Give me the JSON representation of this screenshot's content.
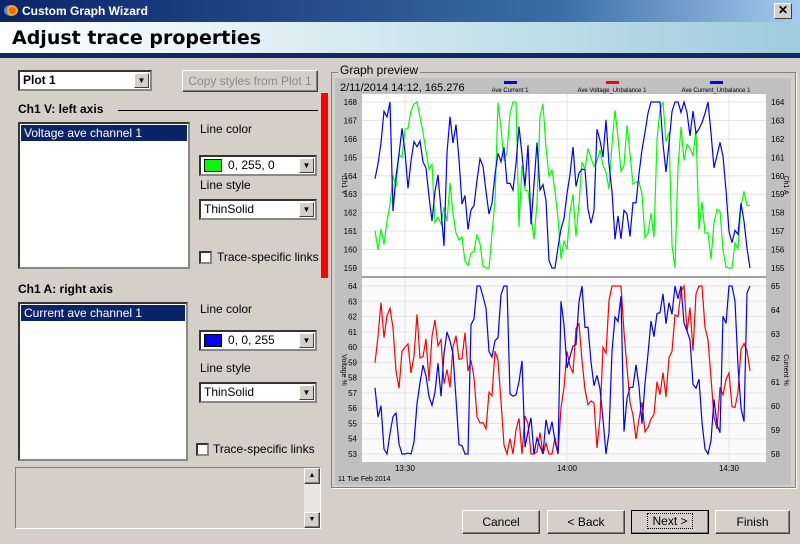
{
  "window": {
    "title": "Custom Graph Wizard",
    "close_label": "✕"
  },
  "header": {
    "title": "Adjust trace properties"
  },
  "plot_select": {
    "value": "Plot  1"
  },
  "copy_button": {
    "label": "Copy styles from Plot 1"
  },
  "left_axis": {
    "heading": "Ch1 V: left axis",
    "traces": [
      "Voltage ave channel 1"
    ],
    "line_color_label": "Line color",
    "line_color": "0, 255, 0",
    "line_color_hex": "#00ff00",
    "line_style_label": "Line style",
    "line_style": "ThinSolid",
    "links_label": "Trace-specific links",
    "links_checked": false
  },
  "right_axis": {
    "heading": "Ch1 A: right axis",
    "traces": [
      "Current ave channel 1"
    ],
    "line_color_label": "Line color",
    "line_color": "0, 0, 255",
    "line_color_hex": "#0000ff",
    "line_style_label": "Line style",
    "line_style": "ThinSolid",
    "links_label": "Trace-specific links",
    "links_checked": false
  },
  "preview": {
    "group_label": "Graph preview",
    "cursor_readout": "2/11/2014 14:12, 165.276",
    "legend": [
      {
        "name": "Ave Current 1",
        "color": "#0000ff"
      },
      {
        "name": "Ave Voltage_Unbalance 1",
        "color": "#ff0000"
      },
      {
        "name": "Ave Current_Unbalance 1",
        "color": "#0000ff"
      }
    ],
    "date_label": "11 Tue Feb 2014"
  },
  "chart_data": [
    {
      "type": "line",
      "ylabel": "Ch1 V",
      "y2label": "Ch1 A",
      "yticks": [
        168,
        167,
        166,
        165,
        164,
        163,
        162,
        161,
        160,
        159
      ],
      "y2ticks": [
        164,
        163,
        162,
        161,
        160,
        159,
        158,
        157,
        156,
        155
      ],
      "ylim": [
        158.8,
        168.2
      ],
      "series": [
        {
          "color": "#00ff00",
          "axis": "left"
        },
        {
          "color": "#0000ff",
          "axis": "right"
        }
      ]
    },
    {
      "type": "line",
      "ylabel": "Voltage %",
      "y2label": "Current %",
      "yticks": [
        64,
        63,
        62,
        61,
        60,
        59,
        58,
        57,
        56,
        55,
        54,
        53
      ],
      "y2ticks": [
        65,
        64,
        63,
        62,
        61,
        60,
        59,
        58
      ],
      "ylim": [
        52.8,
        64.3
      ],
      "xticks": [
        "13:30",
        "14:00",
        "14:30"
      ],
      "series": [
        {
          "color": "#ff0000",
          "axis": "left"
        },
        {
          "color": "#0000ff",
          "axis": "right"
        }
      ]
    }
  ],
  "buttons": {
    "cancel": "Cancel",
    "back": "< Back",
    "next": "Next >",
    "finish": "Finish"
  },
  "colors": {
    "accent_bar": "#ff0000",
    "selection": "#0a246a"
  }
}
